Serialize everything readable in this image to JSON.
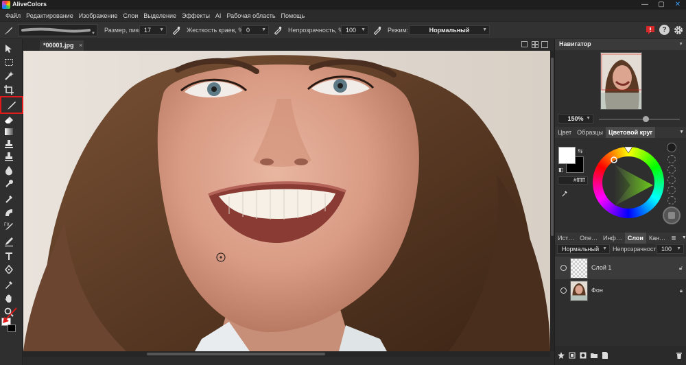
{
  "app": {
    "title": "AliveColors",
    "min": "—",
    "max": "▢",
    "close": "✕"
  },
  "menu": [
    "Файл",
    "Редактирование",
    "Изображение",
    "Слои",
    "Выделение",
    "Эффекты",
    "AI",
    "Рабочая область",
    "Помощь"
  ],
  "options": {
    "size_label": "Размер, пикс",
    "size_value": "17",
    "hardness_label": "Жесткость краев, %",
    "hardness_value": "0",
    "opacity_label": "Непрозрачность, %",
    "opacity_value": "100",
    "mode_label": "Режим:",
    "mode_value": "Нормальный"
  },
  "document": {
    "tab_name": "*00001.jpg",
    "tab_close": "×"
  },
  "navigator": {
    "title": "Навигатор",
    "zoom": "150%"
  },
  "color_tabs": [
    "Цвет",
    "Образцы",
    "Цветовой круг"
  ],
  "color": {
    "foreground": "#ffffff",
    "background": "#000000",
    "hex": "#ffffff",
    "accent": "#e0191a"
  },
  "layers_tabs": [
    "Ист…",
    "Опе…",
    "Инф…",
    "Слои",
    "Кан…"
  ],
  "layers": {
    "blend_mode": "Нормальный",
    "opacity_label": "Непрозрачность",
    "opacity_value": "100",
    "items": [
      {
        "name": "Слой 1"
      },
      {
        "name": "Фон"
      }
    ]
  },
  "tools": [
    "move-tool-icon",
    "selection-tool-icon",
    "magic-wand-icon",
    "crop-icon",
    "brush-icon",
    "eraser-icon",
    "gradient-icon",
    "stamp-icon",
    "clone-icon",
    "drop-icon",
    "blur-icon",
    "smudge-icon",
    "sponge-icon",
    "color-replace-icon",
    "pencil-icon",
    "text-icon",
    "pen-icon",
    "eyedropper-icon",
    "hand-icon",
    "zoom-icon"
  ]
}
